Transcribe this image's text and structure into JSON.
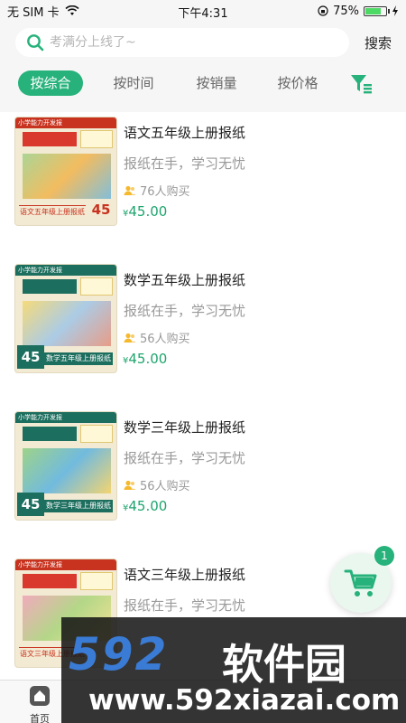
{
  "status": {
    "carrier": "无 SIM 卡",
    "time": "下午4:31",
    "battery": "75%",
    "battery_level": 0.75
  },
  "search": {
    "placeholder": "考满分上线了~",
    "button": "搜索"
  },
  "tabs": [
    {
      "label": "按综合",
      "active": true
    },
    {
      "label": "按时间",
      "active": false
    },
    {
      "label": "按销量",
      "active": false
    },
    {
      "label": "按价格",
      "active": false
    }
  ],
  "filter_icon": "filter-icon",
  "products": [
    {
      "title": "语文五年级上册报纸",
      "subtitle": "报纸在手，学习无忧",
      "buyers": "76人购买",
      "price": "45.00",
      "currency": "¥",
      "thumb": {
        "banner": "小学能力开发报",
        "caption": "语文五年级上册报纸",
        "price_tag": "45"
      }
    },
    {
      "title": "数学五年级上册报纸",
      "subtitle": "报纸在手，学习无忧",
      "buyers": "56人购买",
      "price": "45.00",
      "currency": "¥",
      "thumb": {
        "banner": "小学能力开发报",
        "caption": "数学五年级上册报纸",
        "price_tag": "45"
      }
    },
    {
      "title": "数学三年级上册报纸",
      "subtitle": "报纸在手，学习无忧",
      "buyers": "56人购买",
      "price": "45.00",
      "currency": "¥",
      "thumb": {
        "banner": "小学能力开发报",
        "caption": "数学三年级上册报纸",
        "price_tag": "45"
      }
    },
    {
      "title": "语文三年级上册报纸",
      "subtitle": "报纸在手，学习无忧",
      "buyers": "",
      "price": "",
      "currency": "",
      "thumb": {
        "banner": "小学能力开发报",
        "caption": "语文三年级上册报纸",
        "price_tag": ""
      }
    }
  ],
  "cart": {
    "badge": "1"
  },
  "tabbar": {
    "home_label": "首页"
  },
  "watermark": {
    "brand": "592",
    "brand_cn": "软件园",
    "url": "www.592xiazai.com"
  },
  "colors": {
    "accent": "#26b27a",
    "price": "#1fa56e"
  }
}
